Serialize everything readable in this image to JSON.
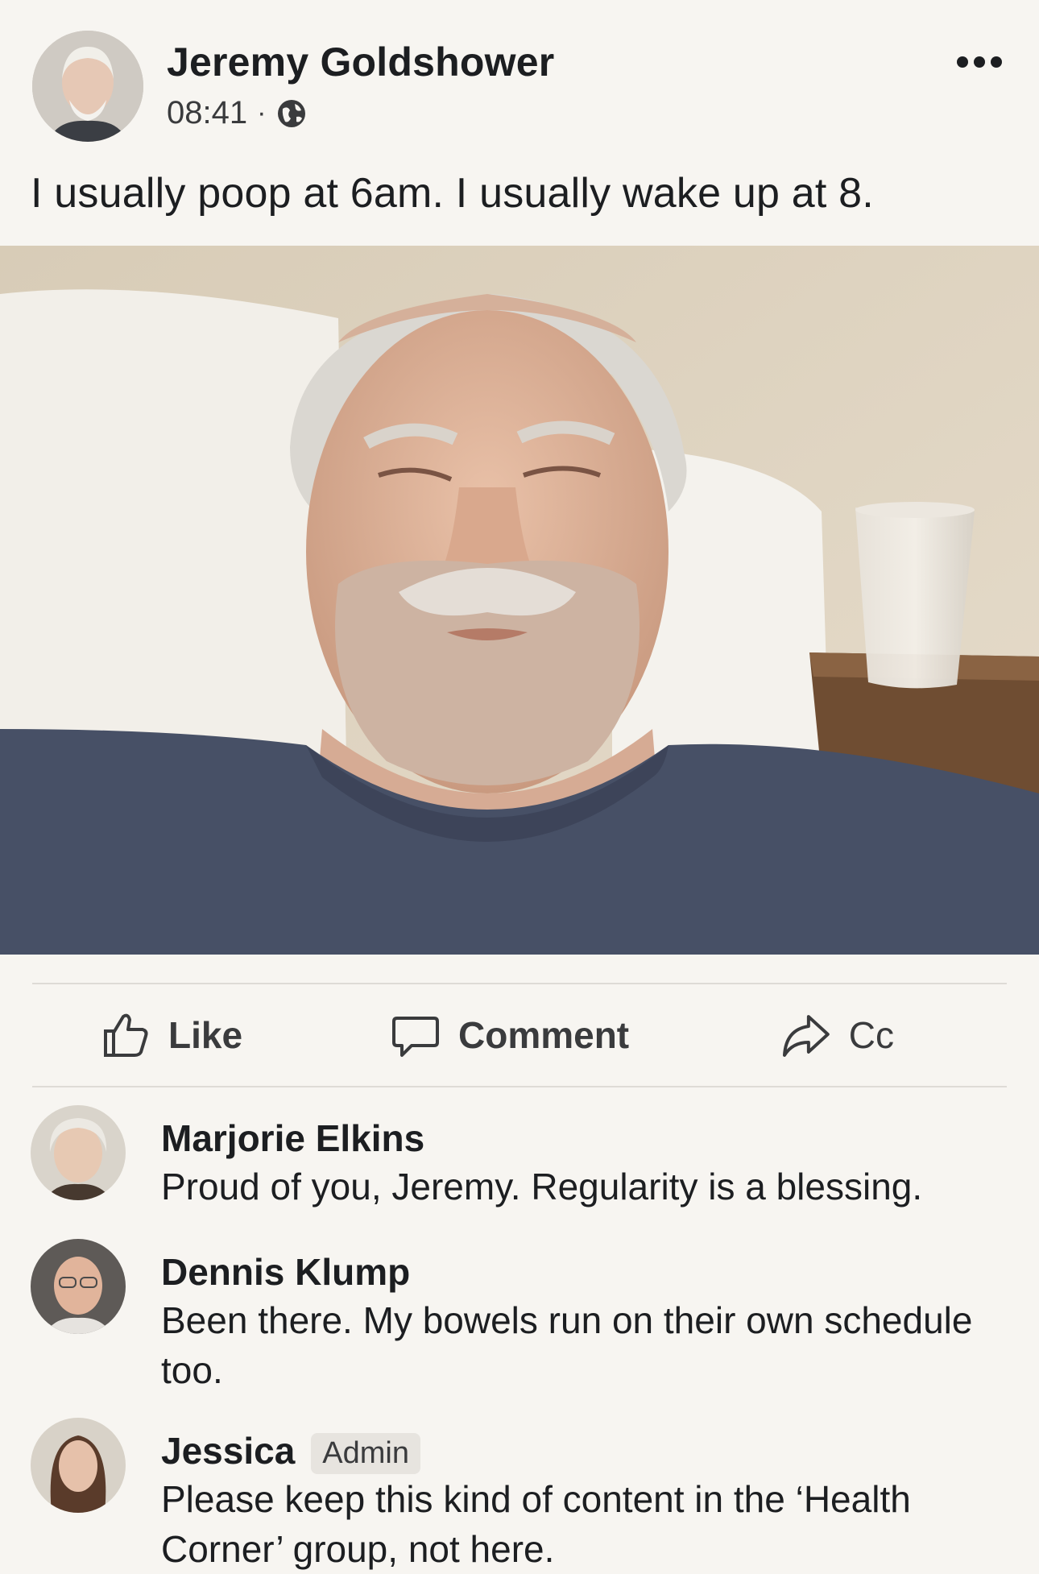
{
  "post": {
    "author": "Jeremy Goldshower",
    "time": "08:41",
    "separator": "·",
    "privacy_icon": "globe-icon",
    "more_icon": "more-icon",
    "text": "I usually poop at 6am. I usually wake up at 8."
  },
  "actions": {
    "like": "Like",
    "comment": "Comment",
    "share": "Cc"
  },
  "comments": [
    {
      "name": "Marjorie Elkins",
      "text": "Proud of you, Jeremy. Regularity is a blessing."
    },
    {
      "name": "Dennis Klump",
      "text": "Been there. My bowels run on their own schedule too."
    },
    {
      "name": "Jessica",
      "badge": "Admin",
      "text": "Please keep this kind of content in the ‘Health Corner’ group, not here."
    }
  ]
}
